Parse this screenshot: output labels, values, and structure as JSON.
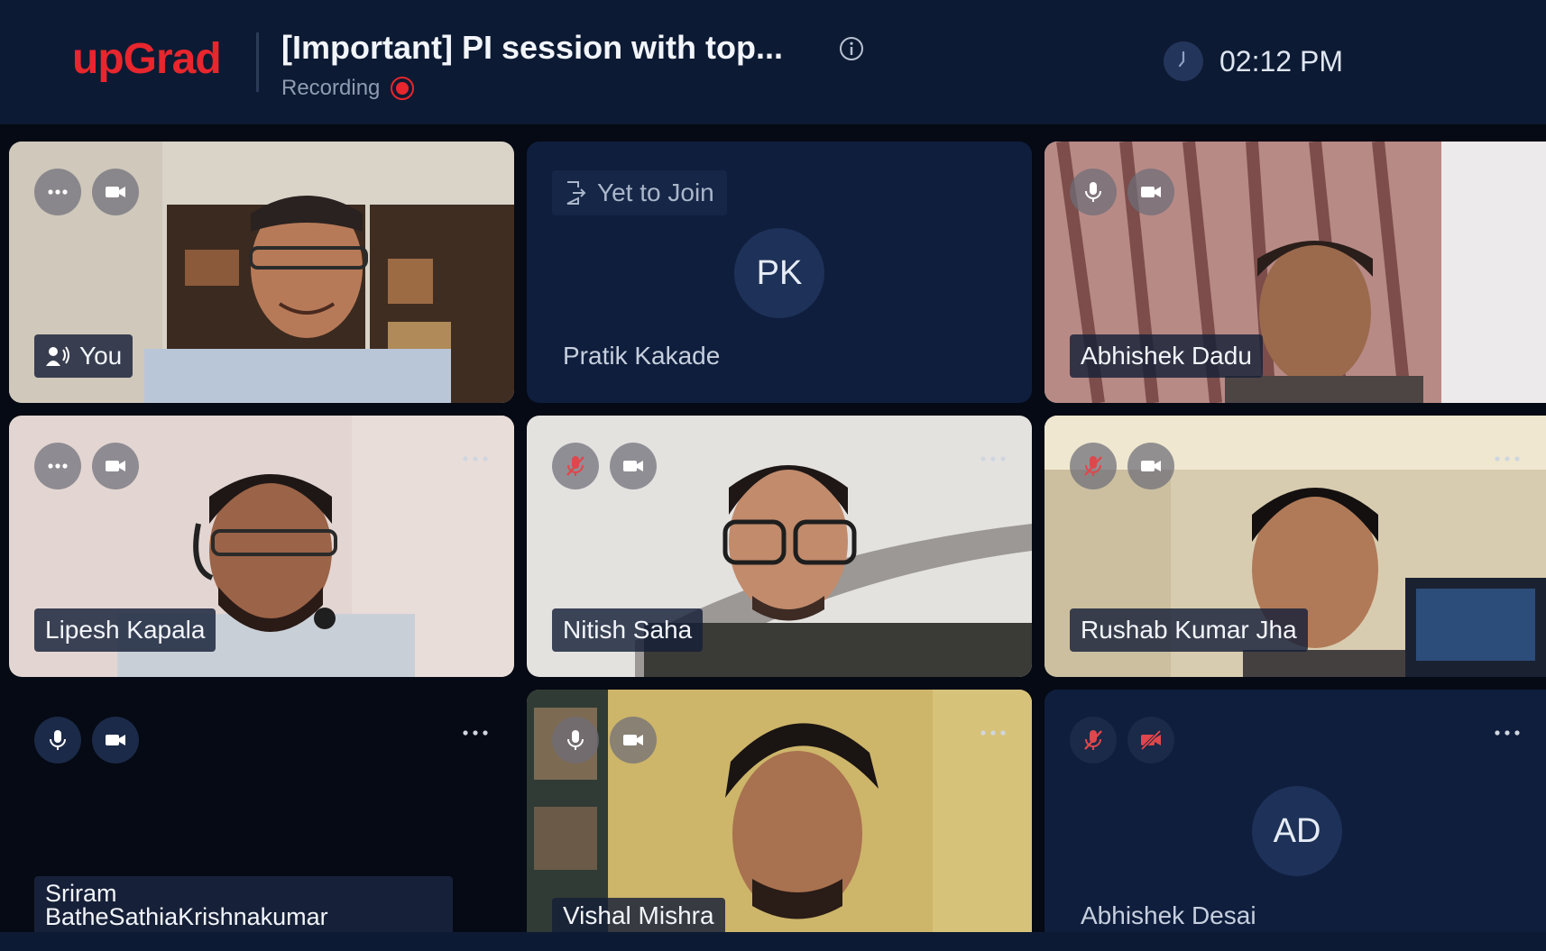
{
  "header": {
    "logo": "upGrad",
    "meeting_title": "[Important] PI session with top...",
    "recording_label": "Recording",
    "clock_time": "02:12 PM"
  },
  "tiles": [
    {
      "name": "You",
      "state": "video"
    },
    {
      "name": "Pratik Kakade",
      "state": "yet-to-join",
      "initials": "PK",
      "status_label": "Yet to Join"
    },
    {
      "name": "Abhishek Dadu",
      "state": "video"
    },
    {
      "name": "Lipesh Kapala",
      "state": "video"
    },
    {
      "name": "Nitish Saha",
      "state": "video",
      "mic": "muted"
    },
    {
      "name": "Rushab Kumar Jha",
      "state": "video",
      "mic": "muted"
    },
    {
      "name": "Sriram BatheSathiaKrishnakumar",
      "state": "no-video"
    },
    {
      "name": "Vishal Mishra",
      "state": "video"
    },
    {
      "name": "Abhishek Desai",
      "state": "no-video",
      "initials": "AD",
      "mic": "muted",
      "camera": "off"
    }
  ],
  "colors": {
    "brand": "#e8262d",
    "header_bg": "#0d1a33",
    "tile_dark": "#0f1e3d",
    "muted_red": "#e0474c"
  }
}
